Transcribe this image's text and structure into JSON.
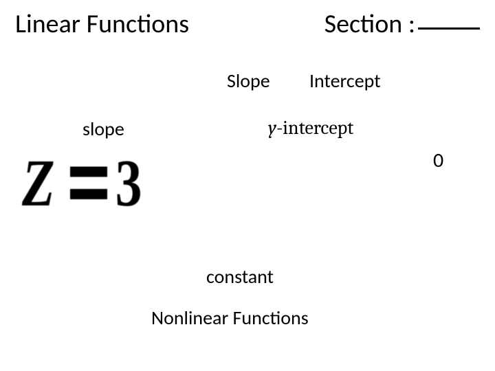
{
  "header": {
    "title_left": "Linear Functions",
    "title_right_prefix": "Section :"
  },
  "columns": {
    "slope": "Slope",
    "intercept": "Intercept"
  },
  "labels": {
    "slope_lower": "slope",
    "y_intercept": "-intercept",
    "y_var": "y",
    "zero": "0",
    "constant": "constant",
    "nonlinear": "Nonlinear Functions"
  },
  "equation": {
    "lhs": "Z",
    "rhs": "3"
  }
}
